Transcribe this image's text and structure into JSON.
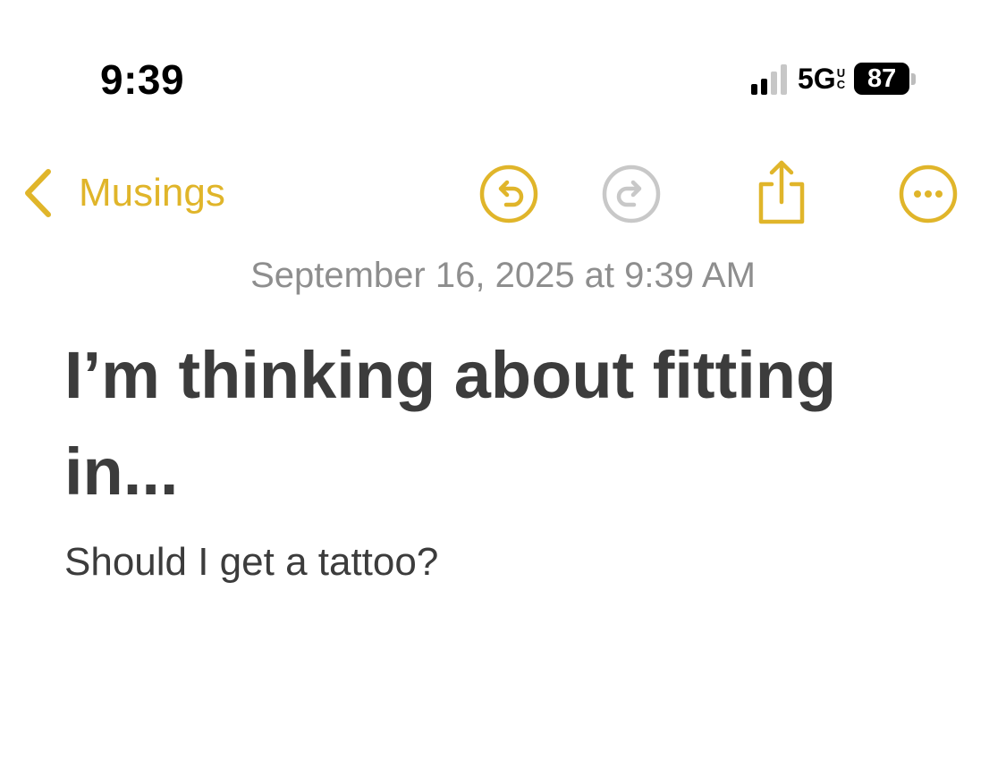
{
  "status_bar": {
    "time": "9:39",
    "network": "5G",
    "network_badge_top": "U",
    "network_badge_bottom": "C",
    "battery": "87"
  },
  "nav": {
    "back_label": "Musings",
    "icons": [
      "chevron-left-icon",
      "undo-icon",
      "redo-icon",
      "share-icon",
      "more-icon"
    ]
  },
  "note": {
    "date": "September 16, 2025 at 9:39 AM",
    "title": "I’m thinking about fitting in...",
    "body": "Should I get a tattoo?"
  },
  "colors": {
    "accent": "#e0b52a",
    "disabled": "#c8c8c8",
    "text": "#3c3c3c",
    "secondary_text": "#8e8e8e"
  }
}
